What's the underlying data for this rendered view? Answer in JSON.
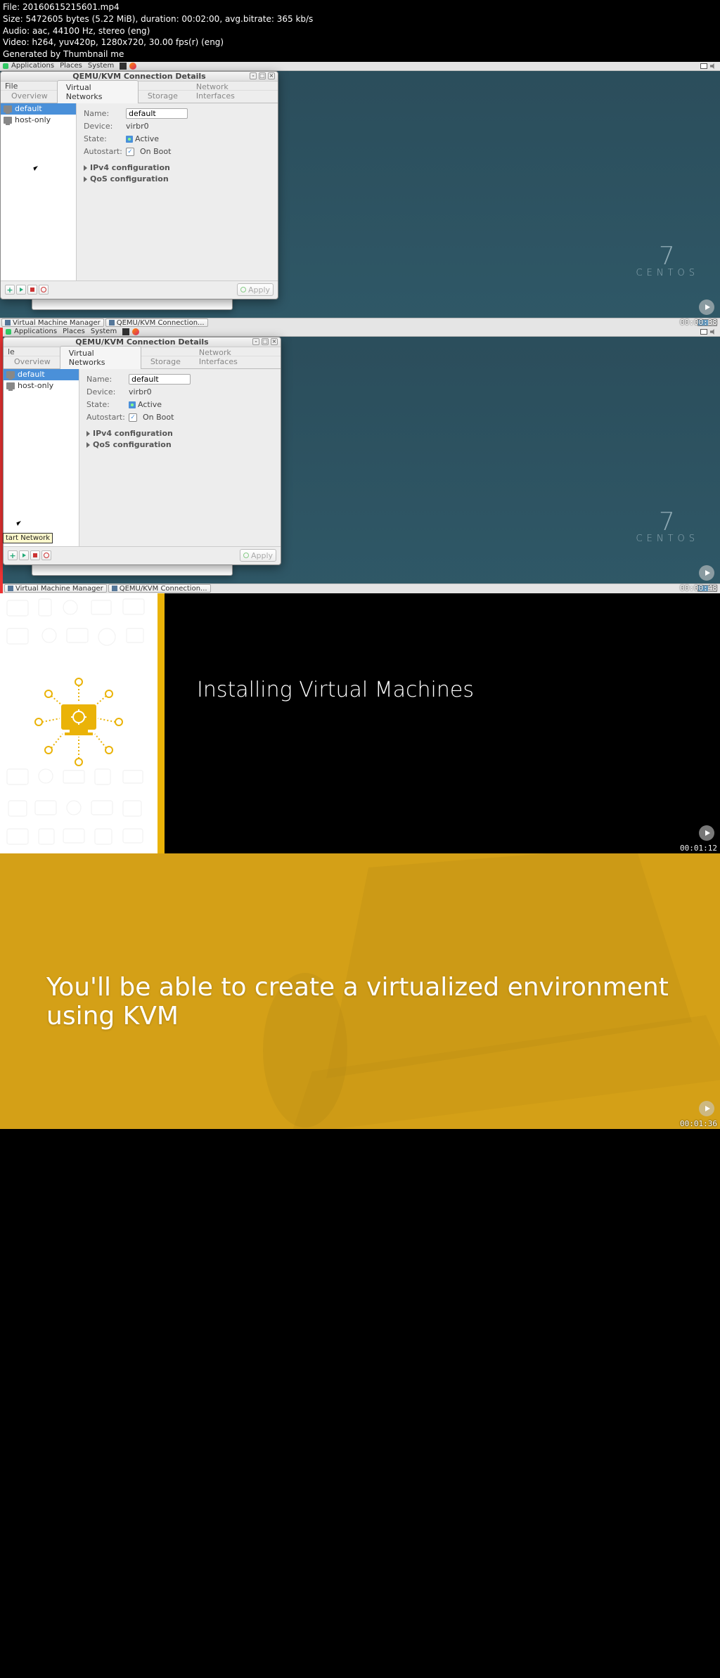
{
  "meta": {
    "file": "File: 20160615215601.mp4",
    "size": "Size: 5472605 bytes (5.22 MiB), duration: 00:02:00, avg.bitrate: 365 kb/s",
    "audio": "Audio: aac, 44100 Hz, stereo (eng)",
    "video": "Video: h264, yuv420p, 1280x720, 30.00 fps(r) (eng)",
    "gen": "Generated by Thumbnail me"
  },
  "gnome": {
    "apps": "Applications",
    "places": "Places",
    "system": "System"
  },
  "task": {
    "vmm": "Virtual Machine Manager",
    "conn": "QEMU/KVM Connection..."
  },
  "dlg": {
    "title": "QEMU/KVM Connection Details",
    "file_menu": "File",
    "le_menu": "le",
    "tabs": {
      "overview": "Overview",
      "vnet": "Virtual Networks",
      "storage": "Storage",
      "nif": "Network Interfaces"
    },
    "side": {
      "default": "default",
      "hostonly": "host-only"
    },
    "labels": {
      "name": "Name:",
      "device": "Device:",
      "state": "State:",
      "autostart": "Autostart:"
    },
    "vals": {
      "name": "default",
      "device": "virbr0",
      "state": "Active",
      "autostart": "On Boot"
    },
    "exp": {
      "ipv4": "IPv4 configuration",
      "qos": "QoS configuration"
    },
    "apply": "Apply"
  },
  "tooltip": {
    "start_network": "tart Network"
  },
  "ts": {
    "f1": "00:00:38",
    "f2": "00:00:48",
    "f3": "00:01:12",
    "f4": "00:01:36"
  },
  "centos": {
    "seven": "7",
    "name": "CENTOS"
  },
  "slide3": {
    "title": "Installing Virtual Machines"
  },
  "slide4": {
    "title": "You'll be able to create a virtualized environment using KVM"
  }
}
